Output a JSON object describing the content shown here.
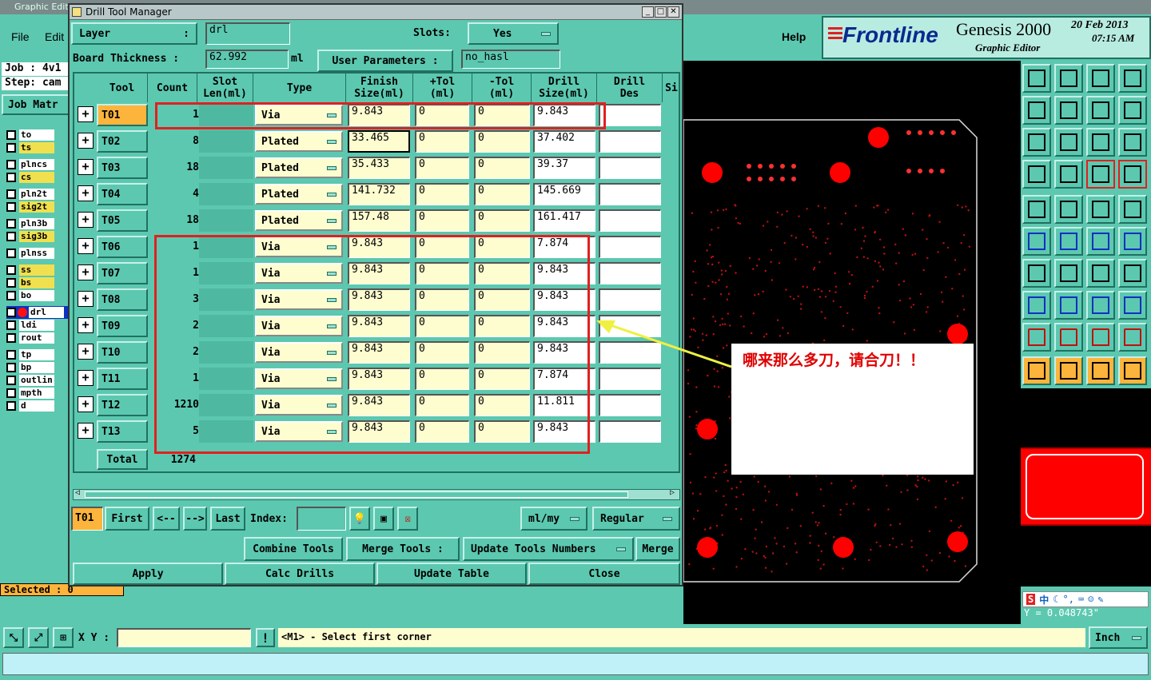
{
  "app": {
    "title_strip": "Graphic Edit",
    "menu_file": "File",
    "menu_edit": "Edit",
    "menu_help": "Help",
    "brand": "Frontline",
    "product": "Genesis 2000",
    "subtitle": "Graphic Editor",
    "date": "20 Feb 2013",
    "time": "07:15 AM",
    "job_label": "Job : 4v1",
    "step_label": "Step: cam",
    "job_matrix": "Job Matr",
    "selected": "Selected : 0",
    "xy_label": "X Y :",
    "status_msg": "<M1> - Select first corner",
    "coord_readout": "Y = 0.048743\"",
    "unit": "Inch",
    "ime_label": "中"
  },
  "layers": [
    {
      "name": "to",
      "highlight": false
    },
    {
      "name": "ts",
      "highlight": true
    },
    {
      "name": "plncs",
      "highlight": false
    },
    {
      "name": "cs",
      "highlight": true
    },
    {
      "name": "pln2t",
      "highlight": false
    },
    {
      "name": "sig2t",
      "highlight": true
    },
    {
      "name": "pln3b",
      "highlight": false
    },
    {
      "name": "sig3b",
      "highlight": true
    },
    {
      "name": "plnss",
      "highlight": false
    },
    {
      "name": "ss",
      "highlight": true
    },
    {
      "name": "bs",
      "highlight": true
    },
    {
      "name": "bo",
      "highlight": false
    },
    {
      "name": "drl",
      "highlight": false
    },
    {
      "name": "ldi",
      "highlight": false
    },
    {
      "name": "rout",
      "highlight": false
    },
    {
      "name": "tp",
      "highlight": false
    },
    {
      "name": "bp",
      "highlight": false
    },
    {
      "name": "outlin",
      "highlight": false
    },
    {
      "name": "mpth",
      "highlight": false
    },
    {
      "name": "d",
      "highlight": false
    }
  ],
  "dialog": {
    "title": "Drill Tool Manager",
    "layer_label": "Layer",
    "layer_colon": ":",
    "layer_value": "drl",
    "slots_label": "Slots:",
    "slots_value": "Yes",
    "thickness_label": "Board Thickness :",
    "thickness_value": "62.992",
    "thickness_unit": "ml",
    "user_params_label": "User Parameters :",
    "user_params_value": "no_hasl",
    "headers": {
      "tool": "Tool",
      "count": "Count",
      "slot_len": "Slot\nLen(ml)",
      "type": "Type",
      "finish": "Finish\nSize(ml)",
      "ptol": "+Tol\n(ml)",
      "mtol": "-Tol\n(ml)",
      "drill": "Drill\nSize(ml)",
      "drill_des": "Drill\nDes",
      "si": "Si"
    },
    "rows": [
      {
        "tool": "T01",
        "count": "1",
        "type": "Via",
        "finish": "9.843",
        "ptol": "0",
        "mtol": "0",
        "drill": "9.843"
      },
      {
        "tool": "T02",
        "count": "8",
        "type": "Plated",
        "finish": "33.465",
        "ptol": "0",
        "mtol": "0",
        "drill": "37.402"
      },
      {
        "tool": "T03",
        "count": "18",
        "type": "Plated",
        "finish": "35.433",
        "ptol": "0",
        "mtol": "0",
        "drill": "39.37"
      },
      {
        "tool": "T04",
        "count": "4",
        "type": "Plated",
        "finish": "141.732",
        "ptol": "0",
        "mtol": "0",
        "drill": "145.669"
      },
      {
        "tool": "T05",
        "count": "18",
        "type": "Plated",
        "finish": "157.48",
        "ptol": "0",
        "mtol": "0",
        "drill": "161.417"
      },
      {
        "tool": "T06",
        "count": "1",
        "type": "Via",
        "finish": "9.843",
        "ptol": "0",
        "mtol": "0",
        "drill": "7.874"
      },
      {
        "tool": "T07",
        "count": "1",
        "type": "Via",
        "finish": "9.843",
        "ptol": "0",
        "mtol": "0",
        "drill": "9.843"
      },
      {
        "tool": "T08",
        "count": "3",
        "type": "Via",
        "finish": "9.843",
        "ptol": "0",
        "mtol": "0",
        "drill": "9.843"
      },
      {
        "tool": "T09",
        "count": "2",
        "type": "Via",
        "finish": "9.843",
        "ptol": "0",
        "mtol": "0",
        "drill": "9.843"
      },
      {
        "tool": "T10",
        "count": "2",
        "type": "Via",
        "finish": "9.843",
        "ptol": "0",
        "mtol": "0",
        "drill": "9.843"
      },
      {
        "tool": "T11",
        "count": "1",
        "type": "Via",
        "finish": "9.843",
        "ptol": "0",
        "mtol": "0",
        "drill": "7.874"
      },
      {
        "tool": "T12",
        "count": "1210",
        "type": "Via",
        "finish": "9.843",
        "ptol": "0",
        "mtol": "0",
        "drill": "11.811"
      },
      {
        "tool": "T13",
        "count": "5",
        "type": "Via",
        "finish": "9.843",
        "ptol": "0",
        "mtol": "0",
        "drill": "9.843"
      }
    ],
    "total_label": "Total",
    "total_value": "1274",
    "current_tool": "T01",
    "nav_first": "First",
    "nav_prev": "<--",
    "nav_next": "-->",
    "nav_last": "Last",
    "index_label": "Index:",
    "units_select": "ml/my",
    "mode_select": "Regular",
    "combine": "Combine Tools",
    "merge_tools": "Merge Tools :",
    "update_numbers": "Update Tools Numbers",
    "merge": "Merge",
    "apply": "Apply",
    "calc": "Calc Drills",
    "update_table": "Update Table",
    "close": "Close"
  },
  "annotation": {
    "text": "哪来那么多刀，请合刀！！",
    "color": "#e00000",
    "box_color": "#e02020",
    "arrow_color": "#f0f040"
  },
  "colors": {
    "teal": "#5cc8b0",
    "field": "#fdfdd0",
    "selected_tool": "#fcb43c",
    "pad_red": "#ff0000"
  }
}
